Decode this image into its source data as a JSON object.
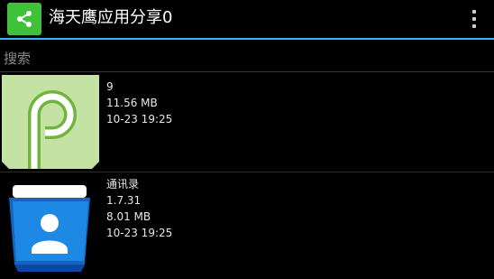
{
  "appbar": {
    "title": "海天鹰应用分享0",
    "share_icon": "share-icon",
    "overflow_icon": "more-vertical-icon",
    "accent_color": "#33b5e5",
    "icon_color": "#3fc23a"
  },
  "search": {
    "placeholder": "搜索",
    "value": ""
  },
  "apps": [
    {
      "icon": "android-p-icon",
      "name": "9",
      "size": "11.56 MB",
      "date": "10-23 19:25"
    },
    {
      "icon": "contacts-icon",
      "name": "通讯录",
      "version": "1.7.31",
      "size": "8.01 MB",
      "date": "10-23 19:25"
    }
  ]
}
